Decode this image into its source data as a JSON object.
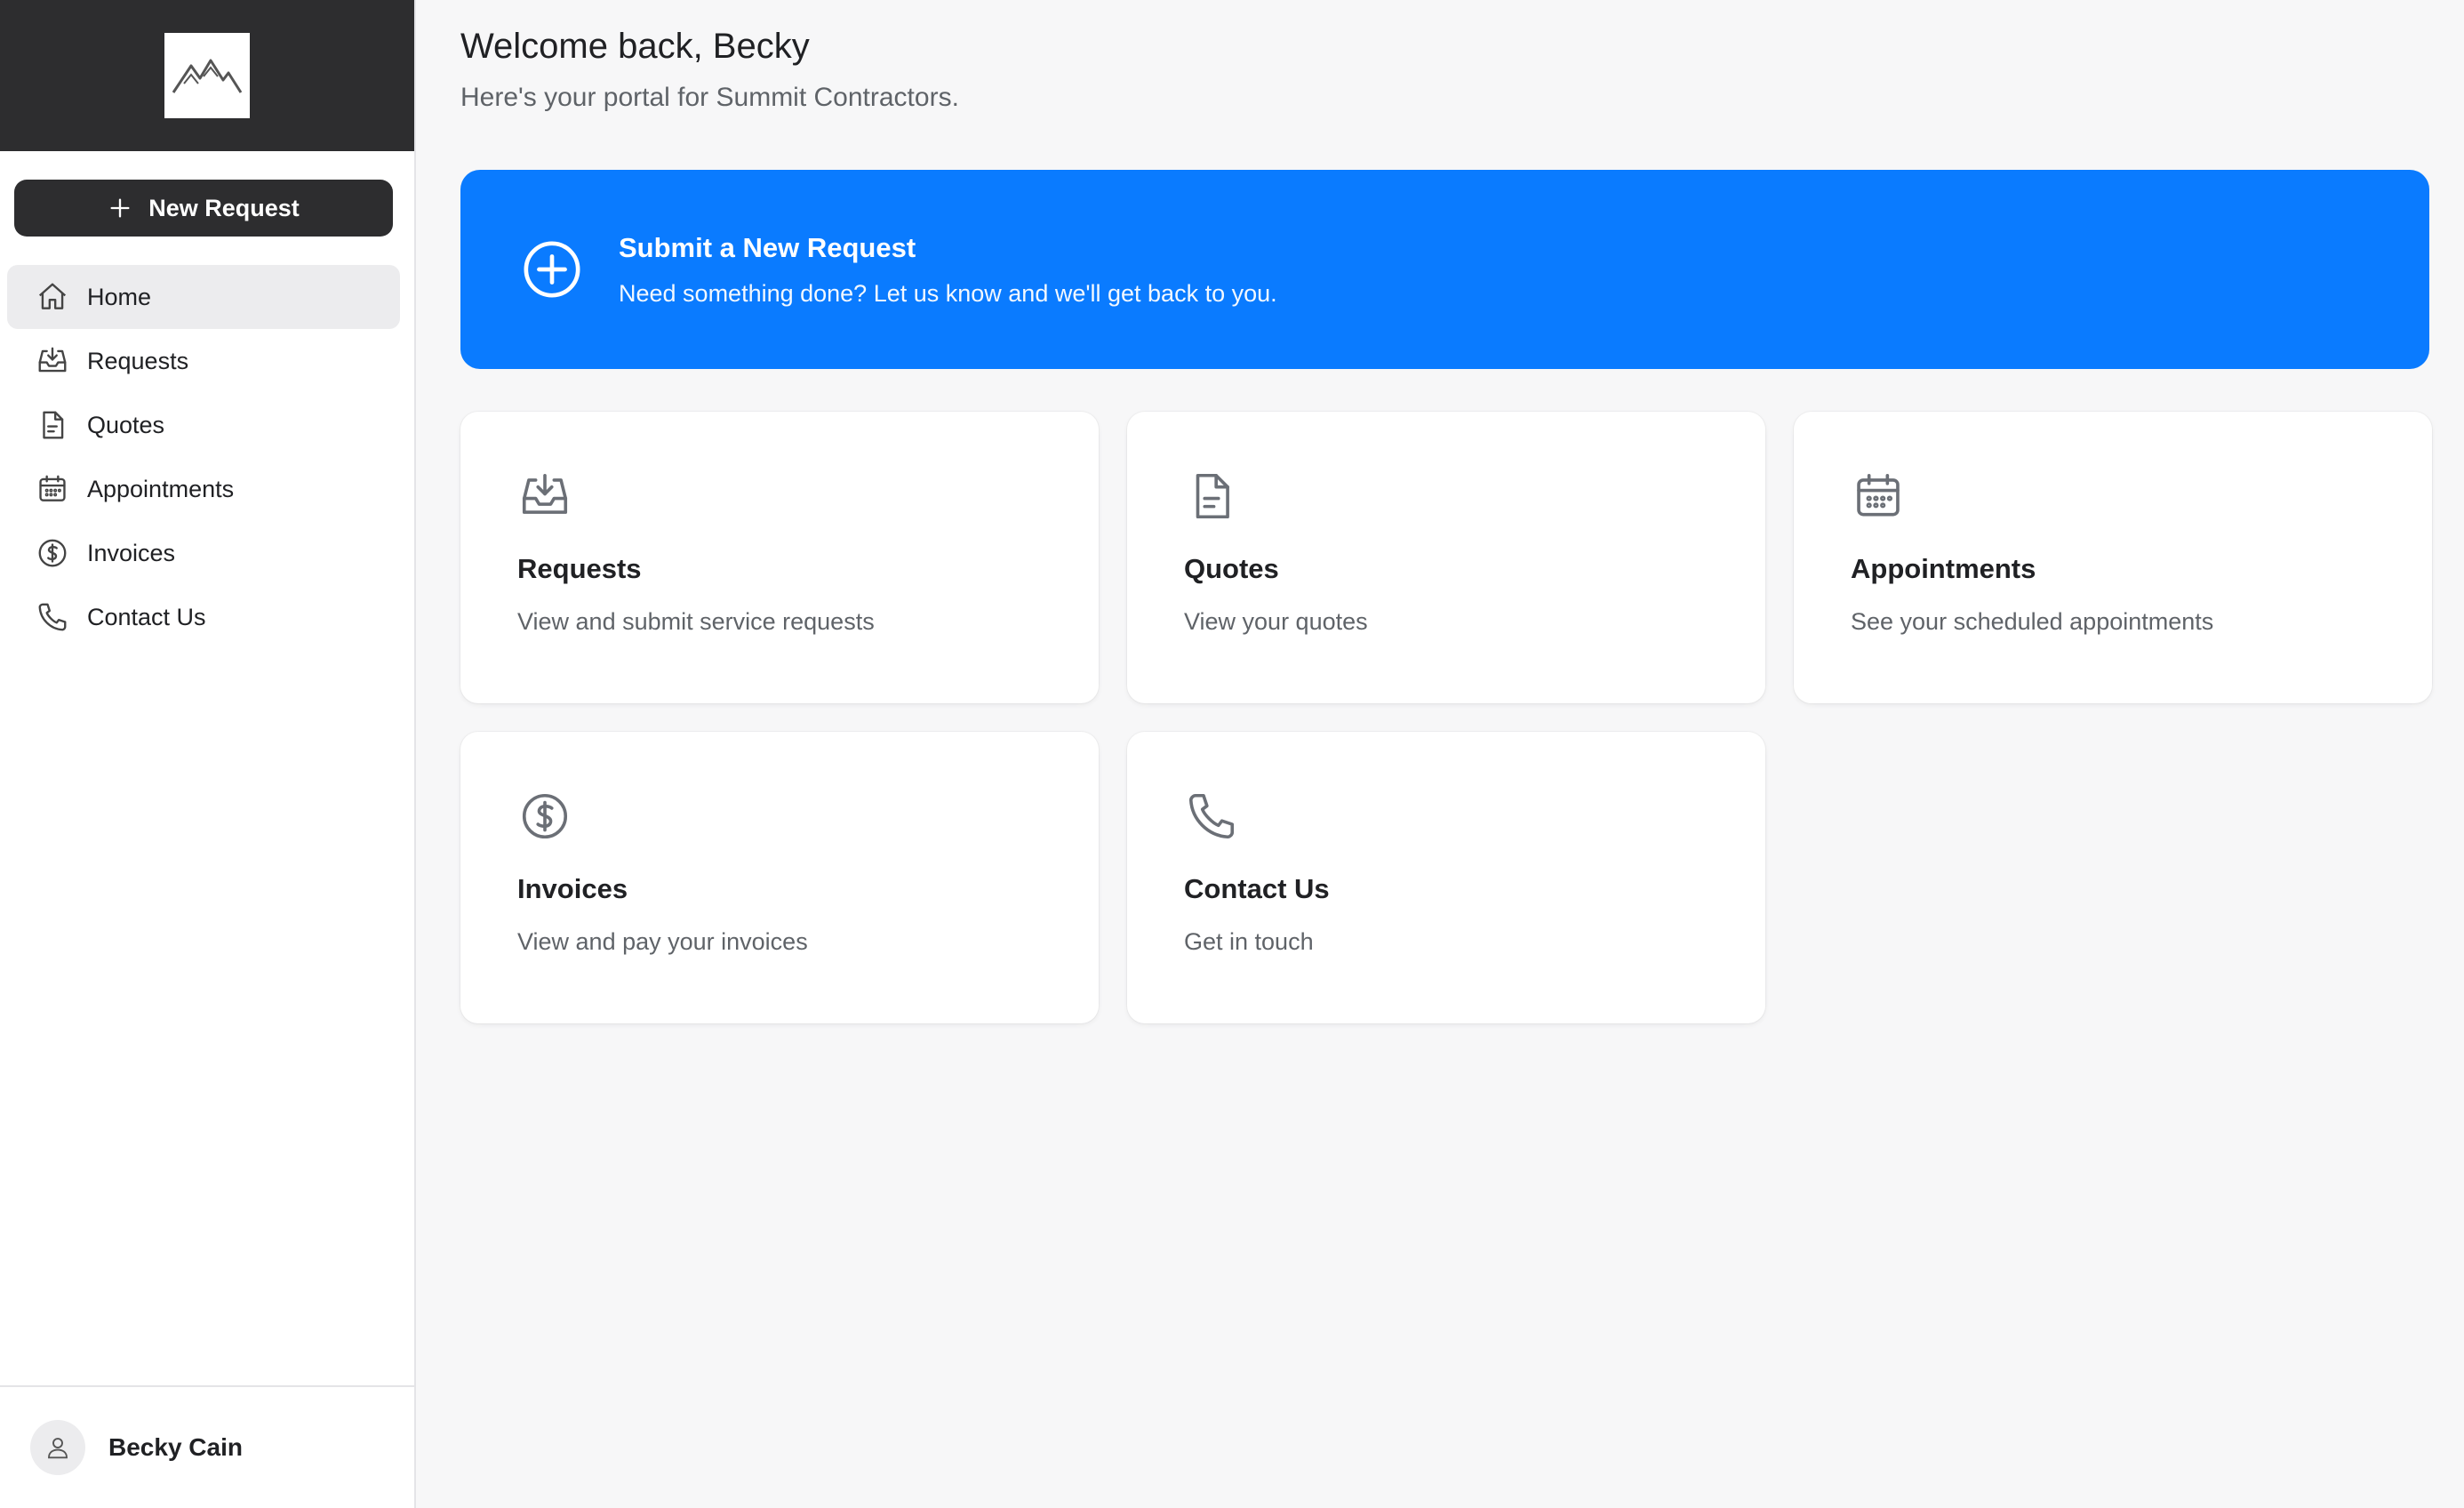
{
  "sidebar": {
    "new_request_label": "New Request",
    "items": [
      {
        "label": "Home",
        "icon": "home-icon",
        "active": true
      },
      {
        "label": "Requests",
        "icon": "inbox-icon"
      },
      {
        "label": "Quotes",
        "icon": "document-icon"
      },
      {
        "label": "Appointments",
        "icon": "calendar-icon"
      },
      {
        "label": "Invoices",
        "icon": "dollar-icon"
      },
      {
        "label": "Contact Us",
        "icon": "phone-icon"
      }
    ],
    "user_name": "Becky Cain"
  },
  "header": {
    "title": "Welcome back, Becky",
    "subtitle": "Here's your portal for Summit Contractors."
  },
  "hero": {
    "title": "Submit a New Request",
    "description": "Need something done? Let us know and we'll get back to you."
  },
  "cards": [
    {
      "title": "Requests",
      "description": "View and submit service requests",
      "icon": "inbox-icon"
    },
    {
      "title": "Quotes",
      "description": "View your quotes",
      "icon": "document-icon"
    },
    {
      "title": "Appointments",
      "description": "See your scheduled appointments",
      "icon": "calendar-icon"
    },
    {
      "title": "Invoices",
      "description": "View and pay your invoices",
      "icon": "dollar-icon"
    },
    {
      "title": "Contact Us",
      "description": "Get in touch",
      "icon": "phone-icon"
    }
  ],
  "colors": {
    "sidebar_header": "#2d2d2f",
    "accent": "#0a7bff",
    "background": "#f7f7f8"
  }
}
